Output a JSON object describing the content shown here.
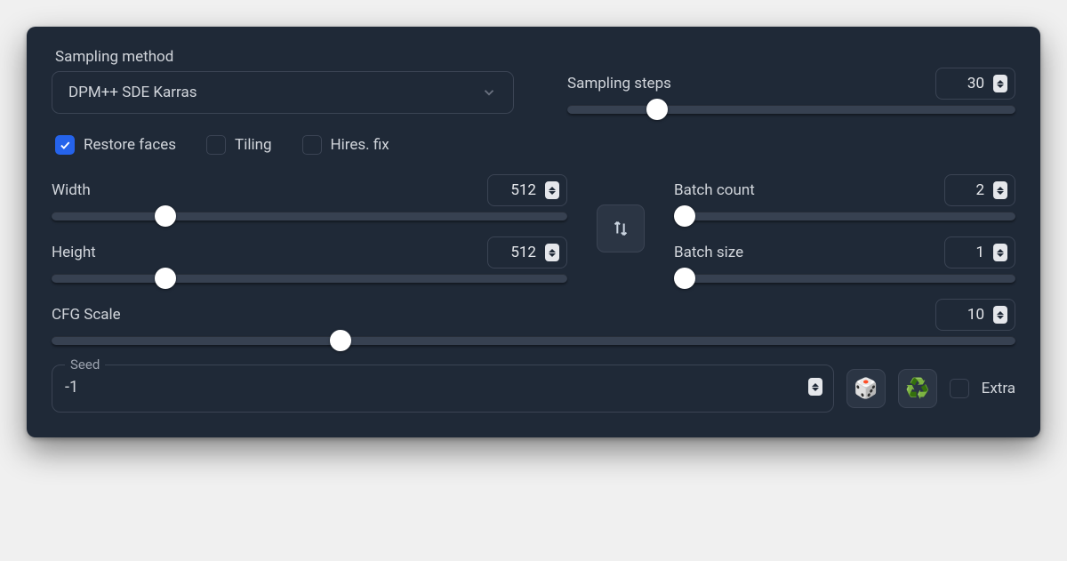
{
  "sampling": {
    "method_label": "Sampling method",
    "method_value": "DPM++ SDE Karras",
    "steps_label": "Sampling steps",
    "steps_value": "30",
    "steps_thumb_pct": 20
  },
  "checkboxes": {
    "restore_faces": {
      "label": "Restore faces",
      "checked": true
    },
    "tiling": {
      "label": "Tiling",
      "checked": false
    },
    "hires_fix": {
      "label": "Hires. fix",
      "checked": false
    }
  },
  "dimensions": {
    "width": {
      "label": "Width",
      "value": "512",
      "thumb_pct": 22
    },
    "height": {
      "label": "Height",
      "value": "512",
      "thumb_pct": 22
    }
  },
  "batch": {
    "count": {
      "label": "Batch count",
      "value": "2",
      "thumb_pct": 3
    },
    "size": {
      "label": "Batch size",
      "value": "1",
      "thumb_pct": 3
    }
  },
  "cfg": {
    "label": "CFG Scale",
    "value": "10",
    "thumb_pct": 30
  },
  "seed": {
    "label": "Seed",
    "value": "-1",
    "dice_icon": "🎲",
    "recycle_icon": "♻️",
    "extra_label": "Extra",
    "extra_checked": false
  }
}
